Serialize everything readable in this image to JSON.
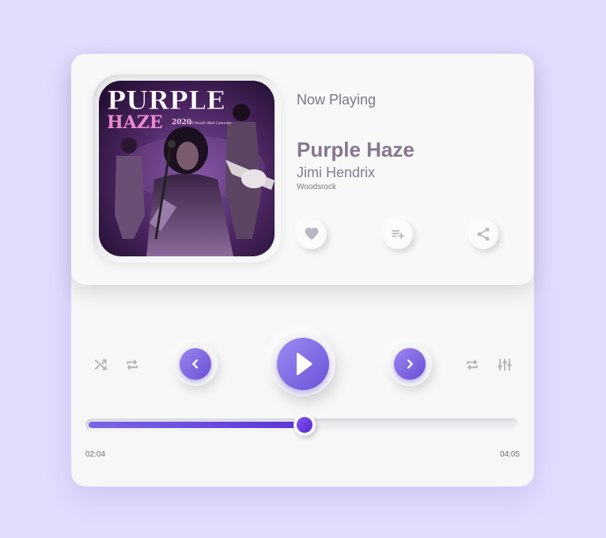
{
  "player": {
    "status_label": "Now Playing",
    "track_title": "Purple Haze",
    "artist": "Jimi Hendrix",
    "album": "Woodsrock",
    "cover": {
      "title_line1": "PURPLE",
      "title_line2": "HAZE",
      "year": "2020",
      "subtitle": "16 Month Wall Calendar"
    }
  },
  "actions": {
    "like_icon": "heart-icon",
    "add_to_queue_icon": "playlist-add-icon",
    "share_icon": "share-icon"
  },
  "controls": {
    "shuffle_icon": "shuffle-icon",
    "repeat_icon": "repeat-icon",
    "previous_icon": "chevron-left-icon",
    "play_icon": "play-icon",
    "next_icon": "chevron-right-icon",
    "equalizer_icon": "equalizer-icon"
  },
  "progress": {
    "current_time": "02:04",
    "total_time": "04:05",
    "fraction": 0.506
  },
  "colors": {
    "background": "#e2dcfd",
    "accent": "#6b52d8",
    "accent_light": "#9d8af2",
    "title_color": "#86778f"
  }
}
